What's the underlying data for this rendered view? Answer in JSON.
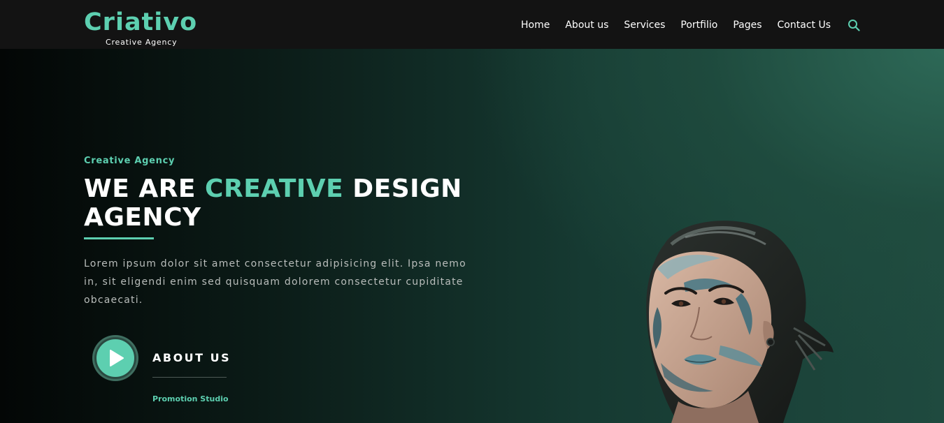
{
  "header": {
    "logo": {
      "title": "Criativo",
      "subtitle": "Creative Agency"
    },
    "nav": [
      {
        "label": "Home"
      },
      {
        "label": "About us"
      },
      {
        "label": "Services"
      },
      {
        "label": "Portfilio"
      },
      {
        "label": "Pages"
      },
      {
        "label": "Contact Us"
      }
    ],
    "search_icon": "search-icon"
  },
  "hero": {
    "eyebrow": "Creative Agency",
    "headline_part1": "WE ARE ",
    "headline_accent": "CREATIVE",
    "headline_part2": " DESIGN AGENCY",
    "lead": "Lorem ipsum dolor sit amet consectetur adipisicing elit. Ipsa nemo in, sit eligendi enim sed quisquam dolorem consectetur cupiditate obcaecati.",
    "cta_label": "ABOUT US",
    "cta_caption": "Promotion Studio",
    "play_icon": "play-icon",
    "image": "woman-with-face-paint"
  },
  "colors": {
    "accent": "#5dcfb0",
    "header_bg": "#131313",
    "text_muted": "#b9bdbb",
    "hero_dark": "#030605",
    "hero_green": "#2e6a58"
  }
}
